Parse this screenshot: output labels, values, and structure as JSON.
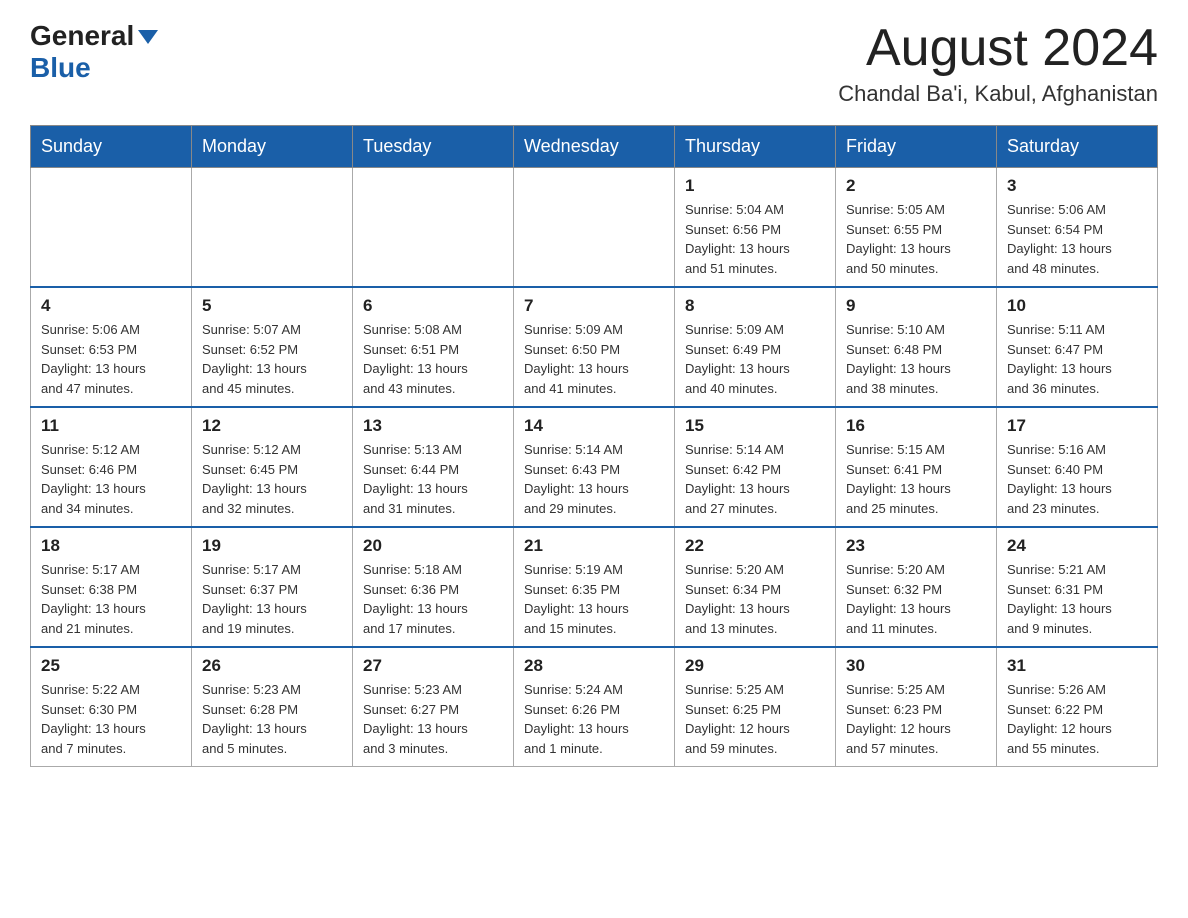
{
  "header": {
    "logo_general": "General",
    "logo_blue": "Blue",
    "month_title": "August 2024",
    "location": "Chandal Ba'i, Kabul, Afghanistan"
  },
  "days_of_week": [
    "Sunday",
    "Monday",
    "Tuesday",
    "Wednesday",
    "Thursday",
    "Friday",
    "Saturday"
  ],
  "weeks": [
    [
      {
        "day": "",
        "info": ""
      },
      {
        "day": "",
        "info": ""
      },
      {
        "day": "",
        "info": ""
      },
      {
        "day": "",
        "info": ""
      },
      {
        "day": "1",
        "info": "Sunrise: 5:04 AM\nSunset: 6:56 PM\nDaylight: 13 hours\nand 51 minutes."
      },
      {
        "day": "2",
        "info": "Sunrise: 5:05 AM\nSunset: 6:55 PM\nDaylight: 13 hours\nand 50 minutes."
      },
      {
        "day": "3",
        "info": "Sunrise: 5:06 AM\nSunset: 6:54 PM\nDaylight: 13 hours\nand 48 minutes."
      }
    ],
    [
      {
        "day": "4",
        "info": "Sunrise: 5:06 AM\nSunset: 6:53 PM\nDaylight: 13 hours\nand 47 minutes."
      },
      {
        "day": "5",
        "info": "Sunrise: 5:07 AM\nSunset: 6:52 PM\nDaylight: 13 hours\nand 45 minutes."
      },
      {
        "day": "6",
        "info": "Sunrise: 5:08 AM\nSunset: 6:51 PM\nDaylight: 13 hours\nand 43 minutes."
      },
      {
        "day": "7",
        "info": "Sunrise: 5:09 AM\nSunset: 6:50 PM\nDaylight: 13 hours\nand 41 minutes."
      },
      {
        "day": "8",
        "info": "Sunrise: 5:09 AM\nSunset: 6:49 PM\nDaylight: 13 hours\nand 40 minutes."
      },
      {
        "day": "9",
        "info": "Sunrise: 5:10 AM\nSunset: 6:48 PM\nDaylight: 13 hours\nand 38 minutes."
      },
      {
        "day": "10",
        "info": "Sunrise: 5:11 AM\nSunset: 6:47 PM\nDaylight: 13 hours\nand 36 minutes."
      }
    ],
    [
      {
        "day": "11",
        "info": "Sunrise: 5:12 AM\nSunset: 6:46 PM\nDaylight: 13 hours\nand 34 minutes."
      },
      {
        "day": "12",
        "info": "Sunrise: 5:12 AM\nSunset: 6:45 PM\nDaylight: 13 hours\nand 32 minutes."
      },
      {
        "day": "13",
        "info": "Sunrise: 5:13 AM\nSunset: 6:44 PM\nDaylight: 13 hours\nand 31 minutes."
      },
      {
        "day": "14",
        "info": "Sunrise: 5:14 AM\nSunset: 6:43 PM\nDaylight: 13 hours\nand 29 minutes."
      },
      {
        "day": "15",
        "info": "Sunrise: 5:14 AM\nSunset: 6:42 PM\nDaylight: 13 hours\nand 27 minutes."
      },
      {
        "day": "16",
        "info": "Sunrise: 5:15 AM\nSunset: 6:41 PM\nDaylight: 13 hours\nand 25 minutes."
      },
      {
        "day": "17",
        "info": "Sunrise: 5:16 AM\nSunset: 6:40 PM\nDaylight: 13 hours\nand 23 minutes."
      }
    ],
    [
      {
        "day": "18",
        "info": "Sunrise: 5:17 AM\nSunset: 6:38 PM\nDaylight: 13 hours\nand 21 minutes."
      },
      {
        "day": "19",
        "info": "Sunrise: 5:17 AM\nSunset: 6:37 PM\nDaylight: 13 hours\nand 19 minutes."
      },
      {
        "day": "20",
        "info": "Sunrise: 5:18 AM\nSunset: 6:36 PM\nDaylight: 13 hours\nand 17 minutes."
      },
      {
        "day": "21",
        "info": "Sunrise: 5:19 AM\nSunset: 6:35 PM\nDaylight: 13 hours\nand 15 minutes."
      },
      {
        "day": "22",
        "info": "Sunrise: 5:20 AM\nSunset: 6:34 PM\nDaylight: 13 hours\nand 13 minutes."
      },
      {
        "day": "23",
        "info": "Sunrise: 5:20 AM\nSunset: 6:32 PM\nDaylight: 13 hours\nand 11 minutes."
      },
      {
        "day": "24",
        "info": "Sunrise: 5:21 AM\nSunset: 6:31 PM\nDaylight: 13 hours\nand 9 minutes."
      }
    ],
    [
      {
        "day": "25",
        "info": "Sunrise: 5:22 AM\nSunset: 6:30 PM\nDaylight: 13 hours\nand 7 minutes."
      },
      {
        "day": "26",
        "info": "Sunrise: 5:23 AM\nSunset: 6:28 PM\nDaylight: 13 hours\nand 5 minutes."
      },
      {
        "day": "27",
        "info": "Sunrise: 5:23 AM\nSunset: 6:27 PM\nDaylight: 13 hours\nand 3 minutes."
      },
      {
        "day": "28",
        "info": "Sunrise: 5:24 AM\nSunset: 6:26 PM\nDaylight: 13 hours\nand 1 minute."
      },
      {
        "day": "29",
        "info": "Sunrise: 5:25 AM\nSunset: 6:25 PM\nDaylight: 12 hours\nand 59 minutes."
      },
      {
        "day": "30",
        "info": "Sunrise: 5:25 AM\nSunset: 6:23 PM\nDaylight: 12 hours\nand 57 minutes."
      },
      {
        "day": "31",
        "info": "Sunrise: 5:26 AM\nSunset: 6:22 PM\nDaylight: 12 hours\nand 55 minutes."
      }
    ]
  ]
}
